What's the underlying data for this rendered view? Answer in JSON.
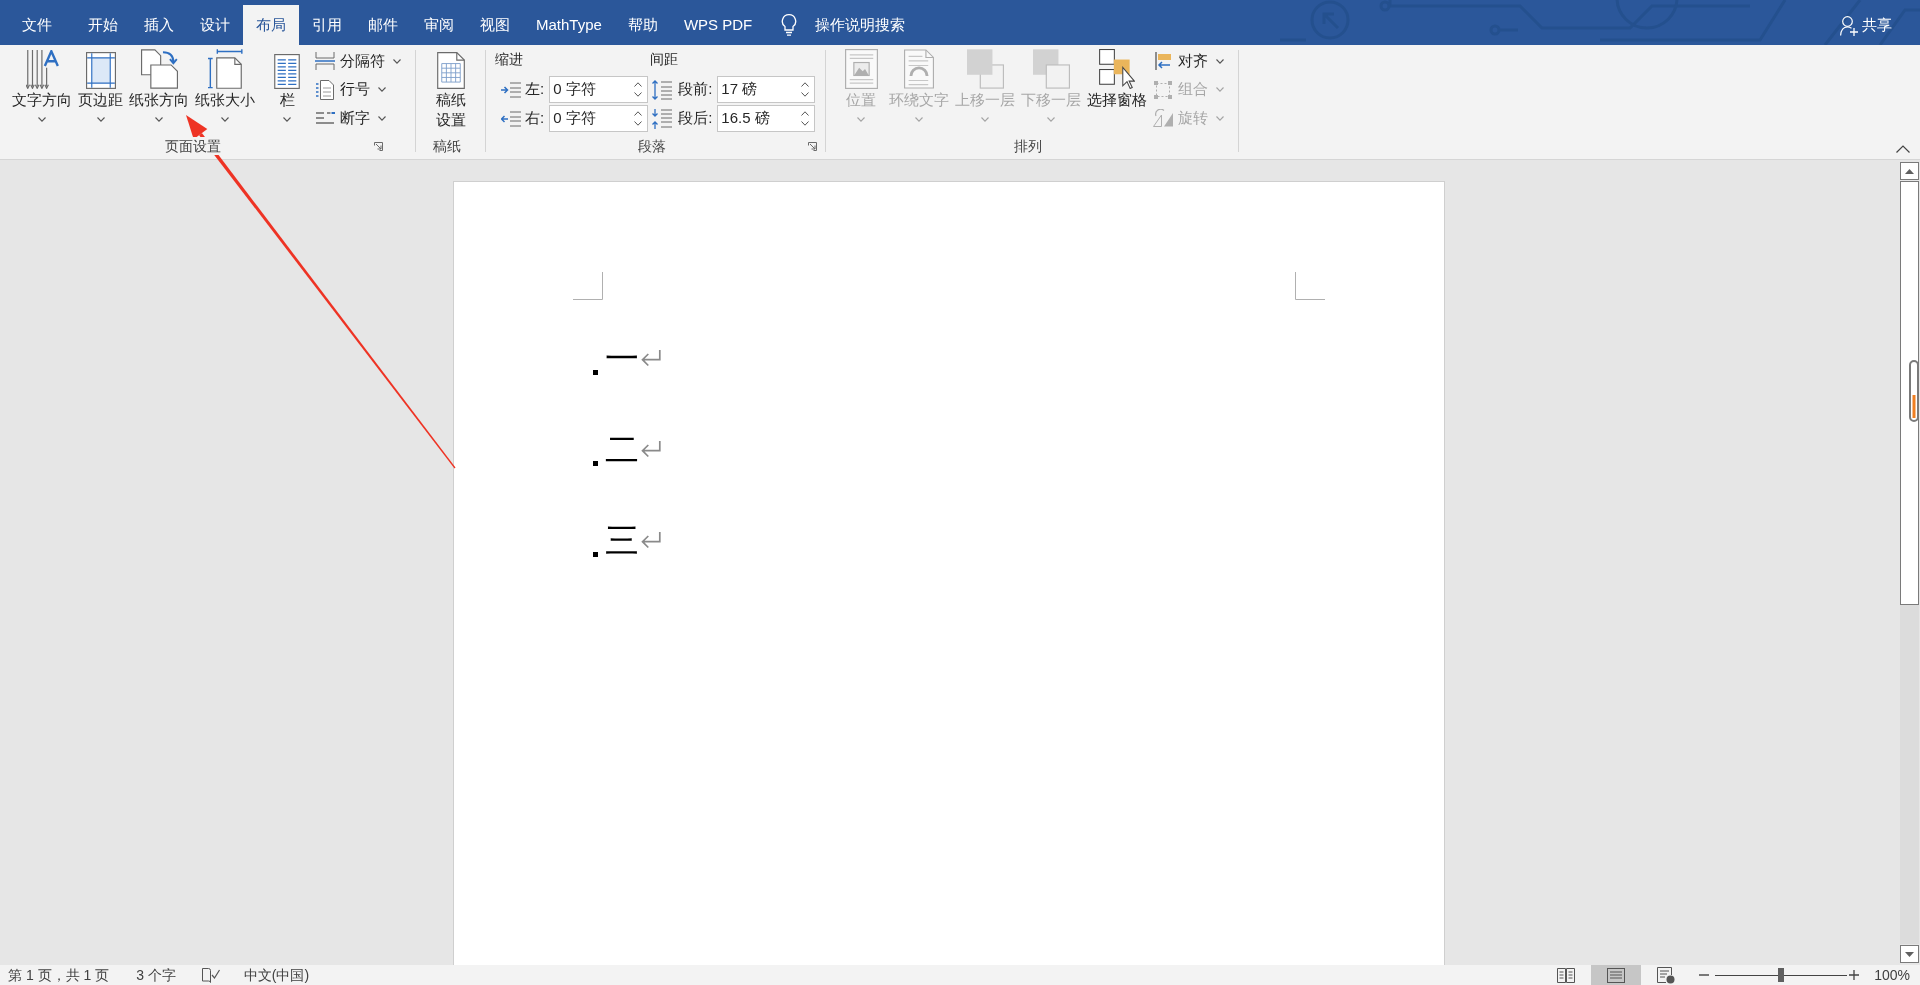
{
  "title_bar": {
    "tabs": [
      {
        "label": "文件",
        "selected": false
      },
      {
        "label": "开始",
        "selected": false
      },
      {
        "label": "插入",
        "selected": false
      },
      {
        "label": "设计",
        "selected": false
      },
      {
        "label": "布局",
        "selected": true
      },
      {
        "label": "引用",
        "selected": false
      },
      {
        "label": "邮件",
        "selected": false
      },
      {
        "label": "审阅",
        "selected": false
      },
      {
        "label": "视图",
        "selected": false
      },
      {
        "label": "MathType",
        "selected": false
      },
      {
        "label": "帮助",
        "selected": false
      },
      {
        "label": "WPS PDF",
        "selected": false
      }
    ],
    "tell_me": {
      "label": "操作说明搜索"
    },
    "share": {
      "label": "共享"
    }
  },
  "ribbon": {
    "groups": [
      {
        "kind": "buttons",
        "label": "页面设置",
        "launcher": true,
        "large_buttons": [
          {
            "label": "文字方向",
            "dropdown": true,
            "disabled": false
          },
          {
            "label": "页边距",
            "dropdown": true,
            "disabled": false
          },
          {
            "label": "纸张方向",
            "dropdown": true,
            "disabled": false
          },
          {
            "label": "纸张大小",
            "dropdown": true,
            "disabled": false
          },
          {
            "label": "栏",
            "dropdown": true,
            "disabled": false
          }
        ],
        "small_buttons": [
          {
            "label": "分隔符",
            "disabled": false
          },
          {
            "label": "行号",
            "disabled": false
          },
          {
            "label": "断字",
            "disabled": false
          }
        ]
      },
      {
        "kind": "buttons",
        "label": "稿纸",
        "launcher": false,
        "large_buttons": [
          {
            "label": "稿纸设置",
            "dropdown": false,
            "disabled": false
          }
        ]
      },
      {
        "kind": "spacing",
        "label": "段落",
        "launcher": true,
        "columns": [
          {
            "heading": "缩进",
            "fields": [
              {
                "label": "左:",
                "value": "0 字符"
              },
              {
                "label": "右:",
                "value": "0 字符"
              }
            ]
          },
          {
            "heading": "间距",
            "fields": [
              {
                "label": "段前:",
                "value": "17 磅"
              },
              {
                "label": "段后:",
                "value": "16.5 磅"
              }
            ]
          }
        ]
      },
      {
        "kind": "buttons",
        "label": "排列",
        "launcher": false,
        "large_buttons": [
          {
            "label": "位置",
            "dropdown": true,
            "disabled": true
          },
          {
            "label": "环绕文字",
            "dropdown": true,
            "disabled": true
          },
          {
            "label": "上移一层",
            "dropdown": true,
            "disabled": true
          },
          {
            "label": "下移一层",
            "dropdown": true,
            "disabled": true
          },
          {
            "label": "选择窗格",
            "dropdown": false,
            "disabled": false
          }
        ],
        "small_buttons": [
          {
            "label": "对齐",
            "disabled": false
          },
          {
            "label": "组合",
            "disabled": true
          },
          {
            "label": "旋转",
            "disabled": true
          }
        ]
      }
    ]
  },
  "document": {
    "paragraphs": [
      {
        "text": "一"
      },
      {
        "text": "二"
      },
      {
        "text": "三"
      }
    ]
  },
  "status_bar": {
    "page_info": "第 1 页，共 1 页",
    "word_count": "3 个字",
    "language": "中文(中国)",
    "views": [
      {
        "selected": false
      },
      {
        "selected": true
      },
      {
        "selected": false
      }
    ],
    "zoom": {
      "level": 0.5,
      "reading": "100%"
    }
  }
}
